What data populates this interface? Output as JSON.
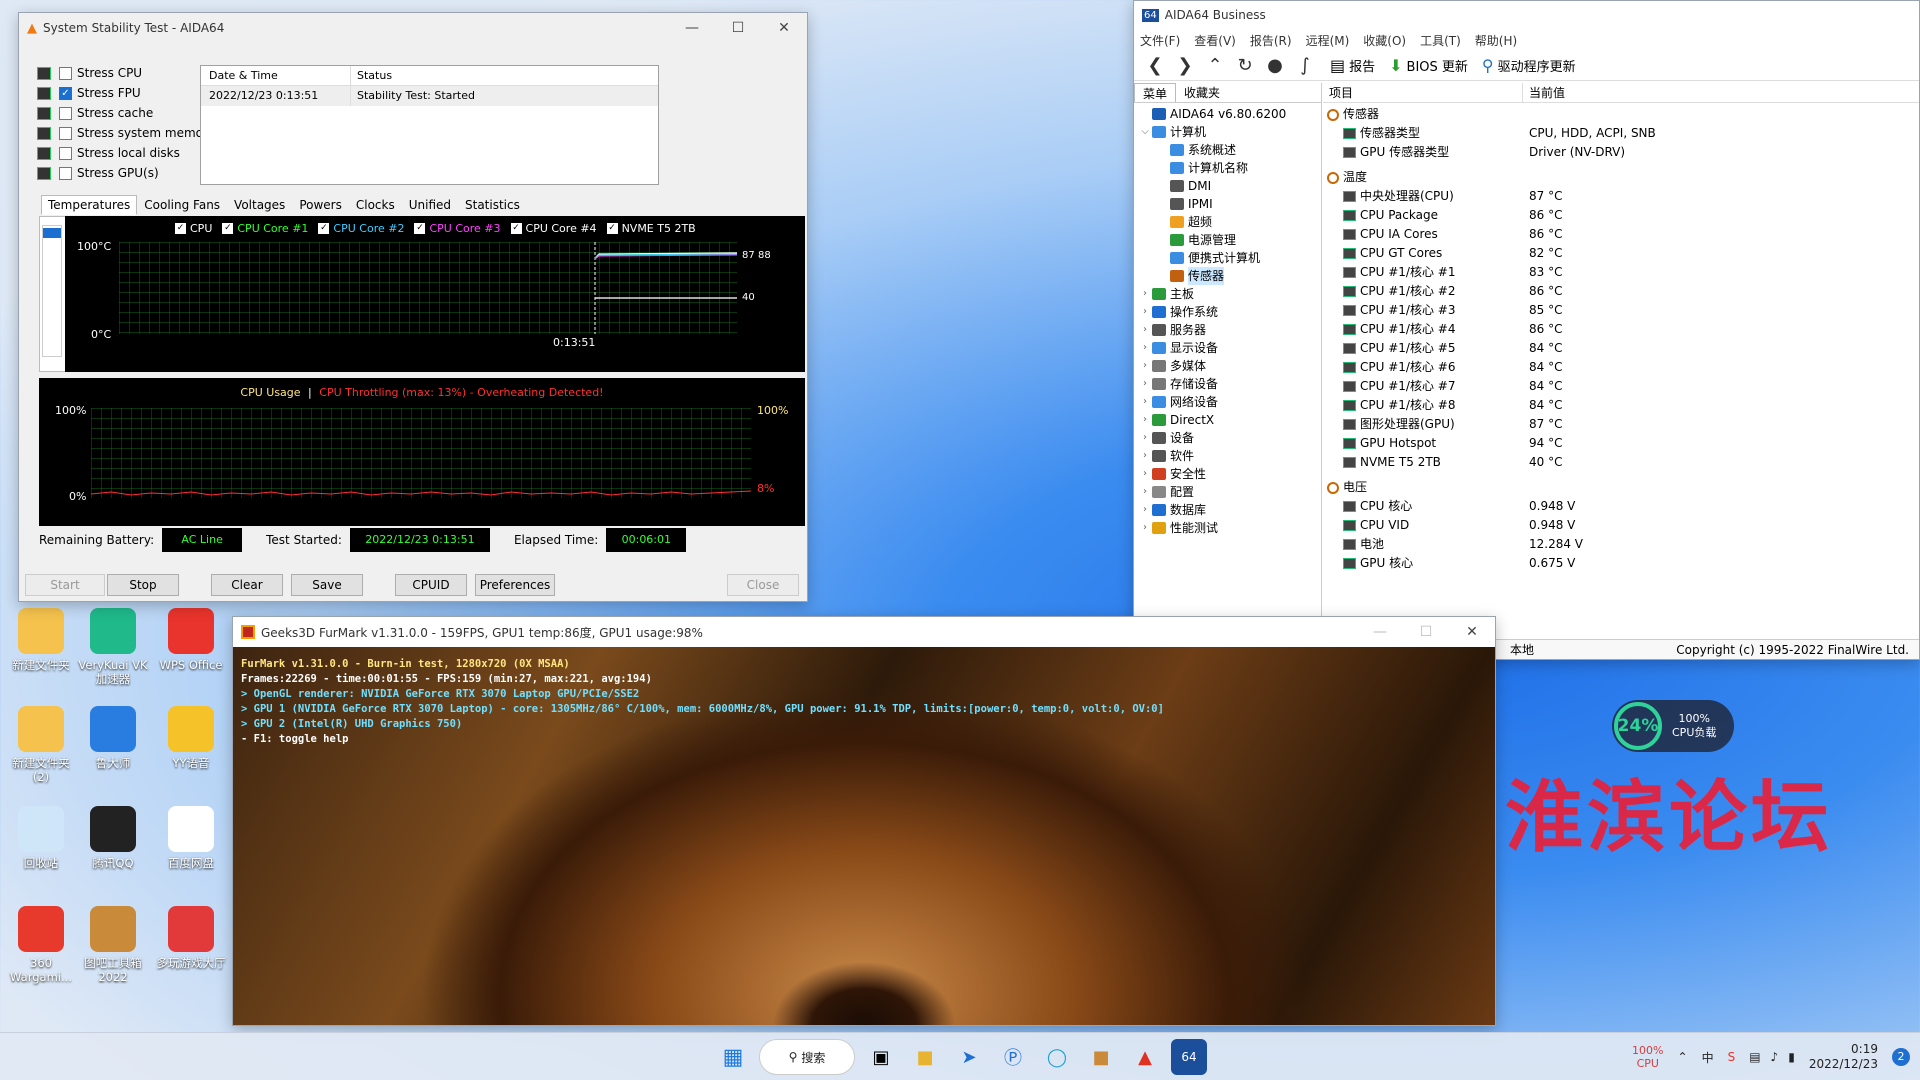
{
  "stability": {
    "title": "System Stability Test - AIDA64",
    "stress_items": [
      {
        "label": "Stress CPU",
        "checked": false
      },
      {
        "label": "Stress FPU",
        "checked": true
      },
      {
        "label": "Stress cache",
        "checked": false
      },
      {
        "label": "Stress system memory",
        "checked": false
      },
      {
        "label": "Stress local disks",
        "checked": false
      },
      {
        "label": "Stress GPU(s)",
        "checked": false
      }
    ],
    "table": {
      "col1": "Date & Time",
      "col2": "Status",
      "rows": [
        {
          "datetime": "2022/12/23 0:13:51",
          "status": "Stability Test: Started"
        }
      ]
    },
    "tabs": [
      "Temperatures",
      "Cooling Fans",
      "Voltages",
      "Powers",
      "Clocks",
      "Unified",
      "Statistics"
    ],
    "temp_graph": {
      "legend": [
        {
          "label": "CPU",
          "color": "#ffffff"
        },
        {
          "label": "CPU Core #1",
          "color": "#33ff33"
        },
        {
          "label": "CPU Core #2",
          "color": "#44ccff"
        },
        {
          "label": "CPU Core #3",
          "color": "#ff44ff"
        },
        {
          "label": "CPU Core #4",
          "color": "#ffffff"
        },
        {
          "label": "NVME T5 2TB",
          "color": "#ffffff"
        }
      ],
      "y_top": "100°C",
      "y_bottom": "0°C",
      "time": "0:13:51",
      "value_high": "87",
      "value_high2": "88",
      "value_low": "40"
    },
    "usage_graph": {
      "label_usage": "CPU Usage",
      "separator": "|",
      "label_throttle": "CPU Throttling (max: 13%) - Overheating Detected!",
      "y_top": "100%",
      "y_bottom": "0%",
      "right_top": "100%",
      "right_bottom": "8%"
    },
    "status": {
      "battery_label": "Remaining Battery:",
      "battery": "AC Line",
      "started_label": "Test Started:",
      "started": "2022/12/23 0:13:51",
      "elapsed_label": "Elapsed Time:",
      "elapsed": "00:06:01"
    },
    "buttons": {
      "start": "Start",
      "stop": "Stop",
      "clear": "Clear",
      "save": "Save",
      "cpuid": "CPUID",
      "preferences": "Preferences",
      "close": "Close"
    }
  },
  "aida": {
    "title": "AIDA64 Business",
    "menu": [
      "文件(F)",
      "查看(V)",
      "报告(R)",
      "远程(M)",
      "收藏(O)",
      "工具(T)",
      "帮助(H)"
    ],
    "toolbar": {
      "report": "报告",
      "bios": "BIOS 更新",
      "driver": "驱动程序更新"
    },
    "left_tabs": [
      "菜单",
      "收藏夹"
    ],
    "tree": [
      {
        "label": "AIDA64 v6.80.6200",
        "level": 0,
        "exp": "",
        "color": "#1b5fb5"
      },
      {
        "label": "计算机",
        "level": 0,
        "exp": "v",
        "color": "#3a8de0"
      },
      {
        "label": "系统概述",
        "level": 1,
        "exp": "",
        "color": "#3a8de0"
      },
      {
        "label": "计算机名称",
        "level": 1,
        "exp": "",
        "color": "#3a8de0"
      },
      {
        "label": "DMI",
        "level": 1,
        "exp": "",
        "color": "#555"
      },
      {
        "label": "IPMI",
        "level": 1,
        "exp": "",
        "color": "#555"
      },
      {
        "label": "超频",
        "level": 1,
        "exp": "",
        "color": "#f0a020"
      },
      {
        "label": "电源管理",
        "level": 1,
        "exp": "",
        "color": "#2a9a3a"
      },
      {
        "label": "便携式计算机",
        "level": 1,
        "exp": "",
        "color": "#3a8de0"
      },
      {
        "label": "传感器",
        "level": 1,
        "exp": "",
        "color": "#c06010",
        "selected": true
      },
      {
        "label": "主板",
        "level": 0,
        "exp": ">",
        "color": "#2a9a3a"
      },
      {
        "label": "操作系统",
        "level": 0,
        "exp": ">",
        "color": "#1f6fd0"
      },
      {
        "label": "服务器",
        "level": 0,
        "exp": ">",
        "color": "#555"
      },
      {
        "label": "显示设备",
        "level": 0,
        "exp": ">",
        "color": "#3a8de0"
      },
      {
        "label": "多媒体",
        "level": 0,
        "exp": ">",
        "color": "#777"
      },
      {
        "label": "存储设备",
        "level": 0,
        "exp": ">",
        "color": "#777"
      },
      {
        "label": "网络设备",
        "level": 0,
        "exp": ">",
        "color": "#3a8de0"
      },
      {
        "label": "DirectX",
        "level": 0,
        "exp": ">",
        "color": "#2a9a3a"
      },
      {
        "label": "设备",
        "level": 0,
        "exp": ">",
        "color": "#555"
      },
      {
        "label": "软件",
        "level": 0,
        "exp": ">",
        "color": "#555"
      },
      {
        "label": "安全性",
        "level": 0,
        "exp": ">",
        "color": "#d04020"
      },
      {
        "label": "配置",
        "level": 0,
        "exp": ">",
        "color": "#888"
      },
      {
        "label": "数据库",
        "level": 0,
        "exp": ">",
        "color": "#1f6fd0"
      },
      {
        "label": "性能测试",
        "level": 0,
        "exp": ">",
        "color": "#e0a010"
      }
    ],
    "right_header": {
      "item": "项目",
      "value": "当前值"
    },
    "groups": [
      {
        "name": "传感器",
        "rows": [
          {
            "k": "传感器类型",
            "v": "CPU, HDD, ACPI, SNB"
          },
          {
            "k": "GPU 传感器类型",
            "v": "Driver  (NV-DRV)"
          }
        ]
      },
      {
        "name": "温度",
        "rows": [
          {
            "k": "中央处理器(CPU)",
            "v": "87 °C"
          },
          {
            "k": "CPU Package",
            "v": "86 °C"
          },
          {
            "k": "CPU IA Cores",
            "v": "86 °C"
          },
          {
            "k": "CPU GT Cores",
            "v": "82 °C"
          },
          {
            "k": "CPU #1/核心 #1",
            "v": "83 °C"
          },
          {
            "k": "CPU #1/核心 #2",
            "v": "86 °C"
          },
          {
            "k": "CPU #1/核心 #3",
            "v": "85 °C"
          },
          {
            "k": "CPU #1/核心 #4",
            "v": "86 °C"
          },
          {
            "k": "CPU #1/核心 #5",
            "v": "84 °C"
          },
          {
            "k": "CPU #1/核心 #6",
            "v": "84 °C"
          },
          {
            "k": "CPU #1/核心 #7",
            "v": "84 °C"
          },
          {
            "k": "CPU #1/核心 #8",
            "v": "84 °C"
          },
          {
            "k": "图形处理器(GPU)",
            "v": "87 °C"
          },
          {
            "k": "GPU Hotspot",
            "v": "94 °C"
          },
          {
            "k": "NVME T5 2TB",
            "v": "40 °C"
          }
        ]
      },
      {
        "name": "电压",
        "rows": [
          {
            "k": "CPU 核心",
            "v": "0.948 V"
          },
          {
            "k": "CPU VID",
            "v": "0.948 V"
          },
          {
            "k": "电池",
            "v": "12.284 V"
          },
          {
            "k": "GPU 核心",
            "v": "0.675 V"
          }
        ]
      }
    ],
    "status_local": "本地",
    "copyright": "Copyright (c) 1995-2022 FinalWire Ltd."
  },
  "furmark": {
    "title": "Geeks3D FurMark v1.31.0.0 - 159FPS, GPU1 temp:86度, GPU1 usage:98%",
    "lines": [
      {
        "text": "FurMark v1.31.0.0 - Burn-in test, 1280x720 (0X MSAA)",
        "color": "#ffe680"
      },
      {
        "text": "Frames:22269 - time:00:01:55 - FPS:159 (min:27, max:221, avg:194)",
        "color": "#ffffff"
      },
      {
        "text": "> OpenGL renderer: NVIDIA GeForce RTX 3070 Laptop GPU/PCIe/SSE2",
        "color": "#6fe0ff"
      },
      {
        "text": "> GPU 1 (NVIDIA GeForce RTX 3070 Laptop) - core: 1305MHz/86° C/100%, mem: 6000MHz/8%, GPU power: 91.1% TDP, limits:[power:0, temp:0, volt:0, OV:0]",
        "color": "#6fe0ff"
      },
      {
        "text": "> GPU 2 (Intel(R) UHD Graphics 750)",
        "color": "#6fe0ff"
      },
      {
        "text": "- F1: toggle help",
        "color": "#ffffff"
      }
    ]
  },
  "desktop": {
    "icons": [
      {
        "label": "新建文件夹",
        "color": "#f4c24d"
      },
      {
        "label": "VeryKuai VK加速器",
        "color": "#1fb98a"
      },
      {
        "label": "WPS Office",
        "color": "#e8342c"
      },
      {
        "label": "新建文件夹 (2)",
        "color": "#f4c24d"
      },
      {
        "label": "鲁大师",
        "color": "#2a7de0"
      },
      {
        "label": "YY语音",
        "color": "#f5c22a"
      },
      {
        "label": "回收站",
        "color": "#cfe6f8"
      },
      {
        "label": "腾讯QQ",
        "color": "#222222"
      },
      {
        "label": "百度网盘",
        "color": "#ffffff"
      },
      {
        "label": "360 Wargami...",
        "color": "#e83a2c"
      },
      {
        "label": "图吧工具箱 2022",
        "color": "#c98a3a"
      },
      {
        "label": "多玩游戏大厅",
        "color": "#e23a3a"
      }
    ],
    "watermark": "淮滨论坛",
    "gauge": {
      "percent": "24%",
      "load": "100%",
      "load_label": "CPU负载"
    }
  },
  "taskbar": {
    "search": "搜索",
    "cpu_pct": "100%",
    "cpu_label": "CPU",
    "time": "0:19",
    "date": "2022/12/23",
    "notifications": "2"
  }
}
